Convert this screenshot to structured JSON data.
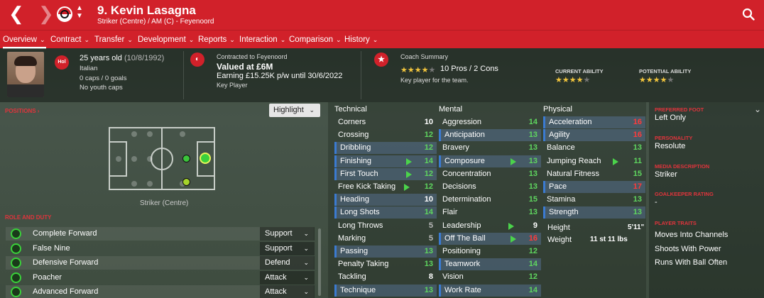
{
  "header": {
    "back_icon": "chevron-left-icon",
    "forward_icon": "chevron-right-icon",
    "title": "9. Kevin Lasagna",
    "subtitle": "Striker (Centre) / AM (C) - Feyenoord",
    "search_icon": "search-icon",
    "accent_color": "#d1212a"
  },
  "tabs": [
    {
      "label": "Overview"
    },
    {
      "label": "Contract"
    },
    {
      "label": "Transfer"
    },
    {
      "label": "Development"
    },
    {
      "label": "Reports"
    },
    {
      "label": "Interaction"
    },
    {
      "label": "Comparison"
    },
    {
      "label": "History"
    }
  ],
  "player": {
    "nation_badge": "Hol",
    "age": "25 years old",
    "dob": "(10/8/1992)",
    "nationality": "Italian",
    "caps": "0 caps / 0 goals",
    "youth_caps": "No youth caps"
  },
  "contract": {
    "contracted_to": "Contracted to Feyenoord",
    "value": "Valued at £6M",
    "earning": "Earning £15.25K p/w until 30/6/2022",
    "status": "Key Player"
  },
  "coach": {
    "label": "Coach Summary",
    "stars": 4,
    "pros_cons": "10 Pros / 2 Cons",
    "summary": "Key player for the team.",
    "current_ability_label": "CURRENT ABILITY",
    "current_ability_stars": 4,
    "potential_ability_label": "POTENTIAL ABILITY",
    "potential_ability_stars": 4
  },
  "positions": {
    "label": "POSITIONS",
    "highlight_button": "Highlight",
    "caption": "Striker (Centre)"
  },
  "roles": {
    "label": "ROLE AND DUTY",
    "items": [
      {
        "name": "Complete Forward",
        "duty": "Support"
      },
      {
        "name": "False Nine",
        "duty": "Support"
      },
      {
        "name": "Defensive Forward",
        "duty": "Defend"
      },
      {
        "name": "Poacher",
        "duty": "Attack"
      },
      {
        "name": "Advanced Forward",
        "duty": "Attack"
      }
    ]
  },
  "attributes": {
    "technical_label": "Technical",
    "mental_label": "Mental",
    "physical_label": "Physical",
    "technical": [
      {
        "name": "Corners",
        "value": "10",
        "c": "vw",
        "hl": false
      },
      {
        "name": "Crossing",
        "value": "12",
        "c": "vg",
        "hl": false
      },
      {
        "name": "Dribbling",
        "value": "12",
        "c": "vg",
        "hl": true
      },
      {
        "name": "Finishing",
        "value": "14",
        "c": "vg",
        "hl": true,
        "arrow": true
      },
      {
        "name": "First Touch",
        "value": "12",
        "c": "vg",
        "hl": true,
        "arrow": true
      },
      {
        "name": "Free Kick Taking",
        "value": "12",
        "c": "vg",
        "hl": false,
        "arrow": true
      },
      {
        "name": "Heading",
        "value": "10",
        "c": "vw",
        "hl": true
      },
      {
        "name": "Long Shots",
        "value": "14",
        "c": "vg",
        "hl": true
      },
      {
        "name": "Long Throws",
        "value": "5",
        "c": "vgr",
        "hl": false
      },
      {
        "name": "Marking",
        "value": "5",
        "c": "vgr",
        "hl": false
      },
      {
        "name": "Passing",
        "value": "13",
        "c": "vg",
        "hl": true
      },
      {
        "name": "Penalty Taking",
        "value": "13",
        "c": "vg",
        "hl": false
      },
      {
        "name": "Tackling",
        "value": "8",
        "c": "vw",
        "hl": false
      },
      {
        "name": "Technique",
        "value": "13",
        "c": "vg",
        "hl": true
      }
    ],
    "mental": [
      {
        "name": "Aggression",
        "value": "14",
        "c": "vg",
        "hl": false
      },
      {
        "name": "Anticipation",
        "value": "13",
        "c": "vg",
        "hl": true
      },
      {
        "name": "Bravery",
        "value": "13",
        "c": "vg",
        "hl": false
      },
      {
        "name": "Composure",
        "value": "13",
        "c": "vg",
        "hl": true,
        "arrow": true
      },
      {
        "name": "Concentration",
        "value": "13",
        "c": "vg",
        "hl": false
      },
      {
        "name": "Decisions",
        "value": "13",
        "c": "vg",
        "hl": false
      },
      {
        "name": "Determination",
        "value": "15",
        "c": "vg",
        "hl": false
      },
      {
        "name": "Flair",
        "value": "13",
        "c": "vg",
        "hl": false
      },
      {
        "name": "Leadership",
        "value": "9",
        "c": "vw",
        "hl": false,
        "arrow": true
      },
      {
        "name": "Off The Ball",
        "value": "16",
        "c": "vr",
        "hl": true,
        "arrow": true
      },
      {
        "name": "Positioning",
        "value": "12",
        "c": "vg",
        "hl": false
      },
      {
        "name": "Teamwork",
        "value": "14",
        "c": "vg",
        "hl": true
      },
      {
        "name": "Vision",
        "value": "12",
        "c": "vg",
        "hl": false
      },
      {
        "name": "Work Rate",
        "value": "14",
        "c": "vg",
        "hl": true
      }
    ],
    "physical": [
      {
        "name": "Acceleration",
        "value": "16",
        "c": "vr",
        "hl": true
      },
      {
        "name": "Agility",
        "value": "16",
        "c": "vr",
        "hl": true
      },
      {
        "name": "Balance",
        "value": "13",
        "c": "vg",
        "hl": false
      },
      {
        "name": "Jumping Reach",
        "value": "11",
        "c": "vg",
        "hl": false,
        "arrow": true
      },
      {
        "name": "Natural Fitness",
        "value": "15",
        "c": "vg",
        "hl": false
      },
      {
        "name": "Pace",
        "value": "17",
        "c": "vr",
        "hl": true
      },
      {
        "name": "Stamina",
        "value": "13",
        "c": "vg",
        "hl": false
      },
      {
        "name": "Strength",
        "value": "13",
        "c": "vg",
        "hl": true
      }
    ],
    "height_label": "Height",
    "height": "5'11\"",
    "weight_label": "Weight",
    "weight": "11 st 11 lbs"
  },
  "side": {
    "foot_label": "PREFERRED FOOT",
    "foot": "Left Only",
    "personality_label": "PERSONALITY",
    "personality": "Resolute",
    "media_label": "MEDIA DESCRIPTION",
    "media": "Striker",
    "gk_label": "GOALKEEPER RATING",
    "gk": "-",
    "traits_label": "PLAYER TRAITS",
    "traits": [
      "Moves Into Channels",
      "Shoots With Power",
      "Runs With Ball Often"
    ]
  }
}
